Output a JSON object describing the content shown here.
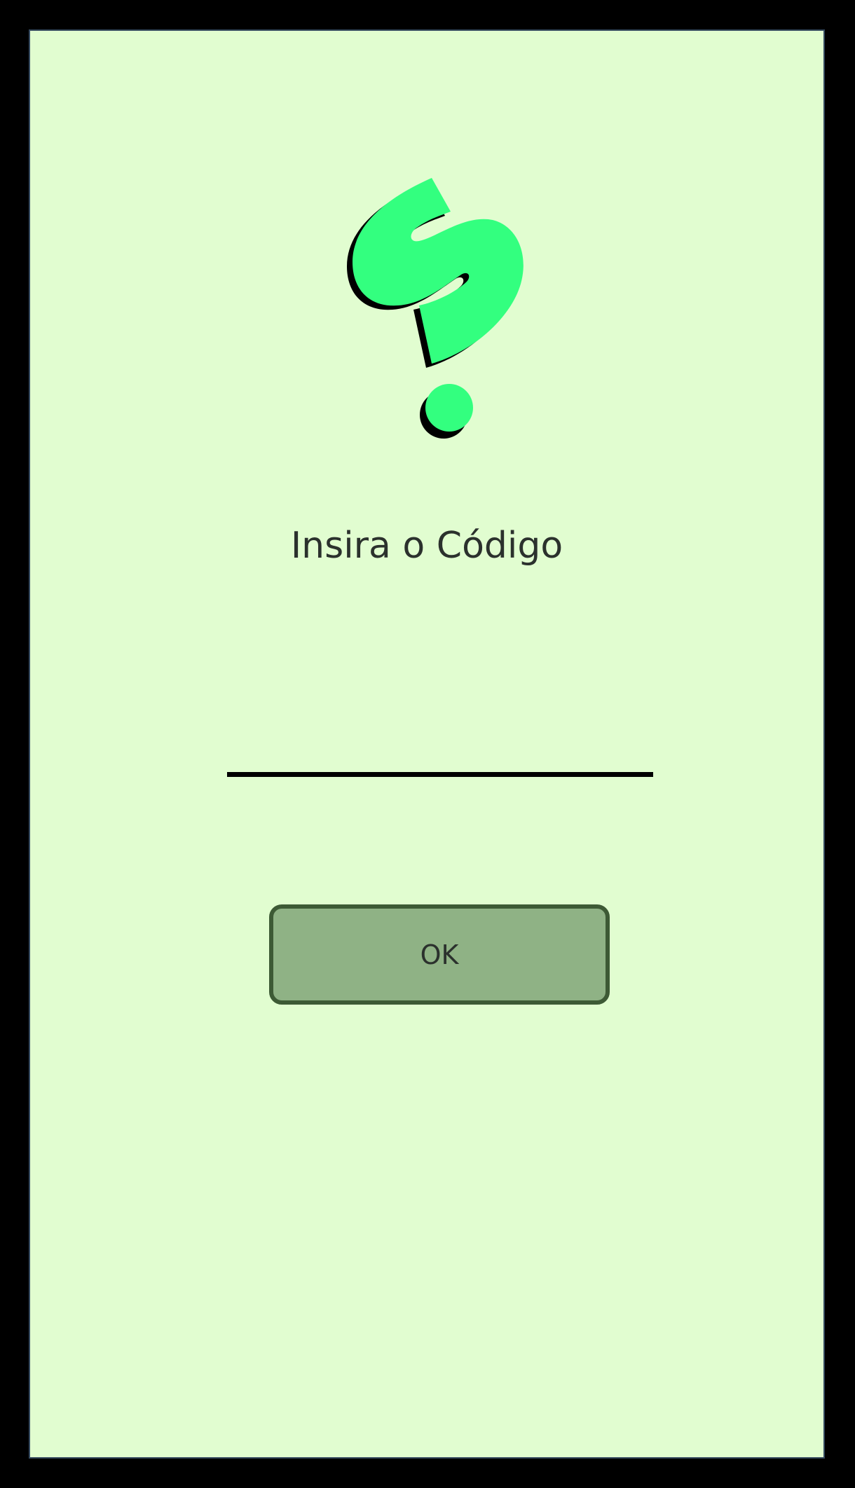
{
  "screen": {
    "title": "Insira o Código"
  },
  "code_input": {
    "value": "",
    "placeholder": ""
  },
  "actions": {
    "ok_label": "OK"
  },
  "colors": {
    "background": "#e1fdd0",
    "logo_green": "#33ff7f",
    "button_fill": "#8fb285",
    "button_border": "#3d5a35",
    "text": "#2b312d"
  },
  "icons": {
    "logo": "dollar-question-mark-logo-icon"
  }
}
